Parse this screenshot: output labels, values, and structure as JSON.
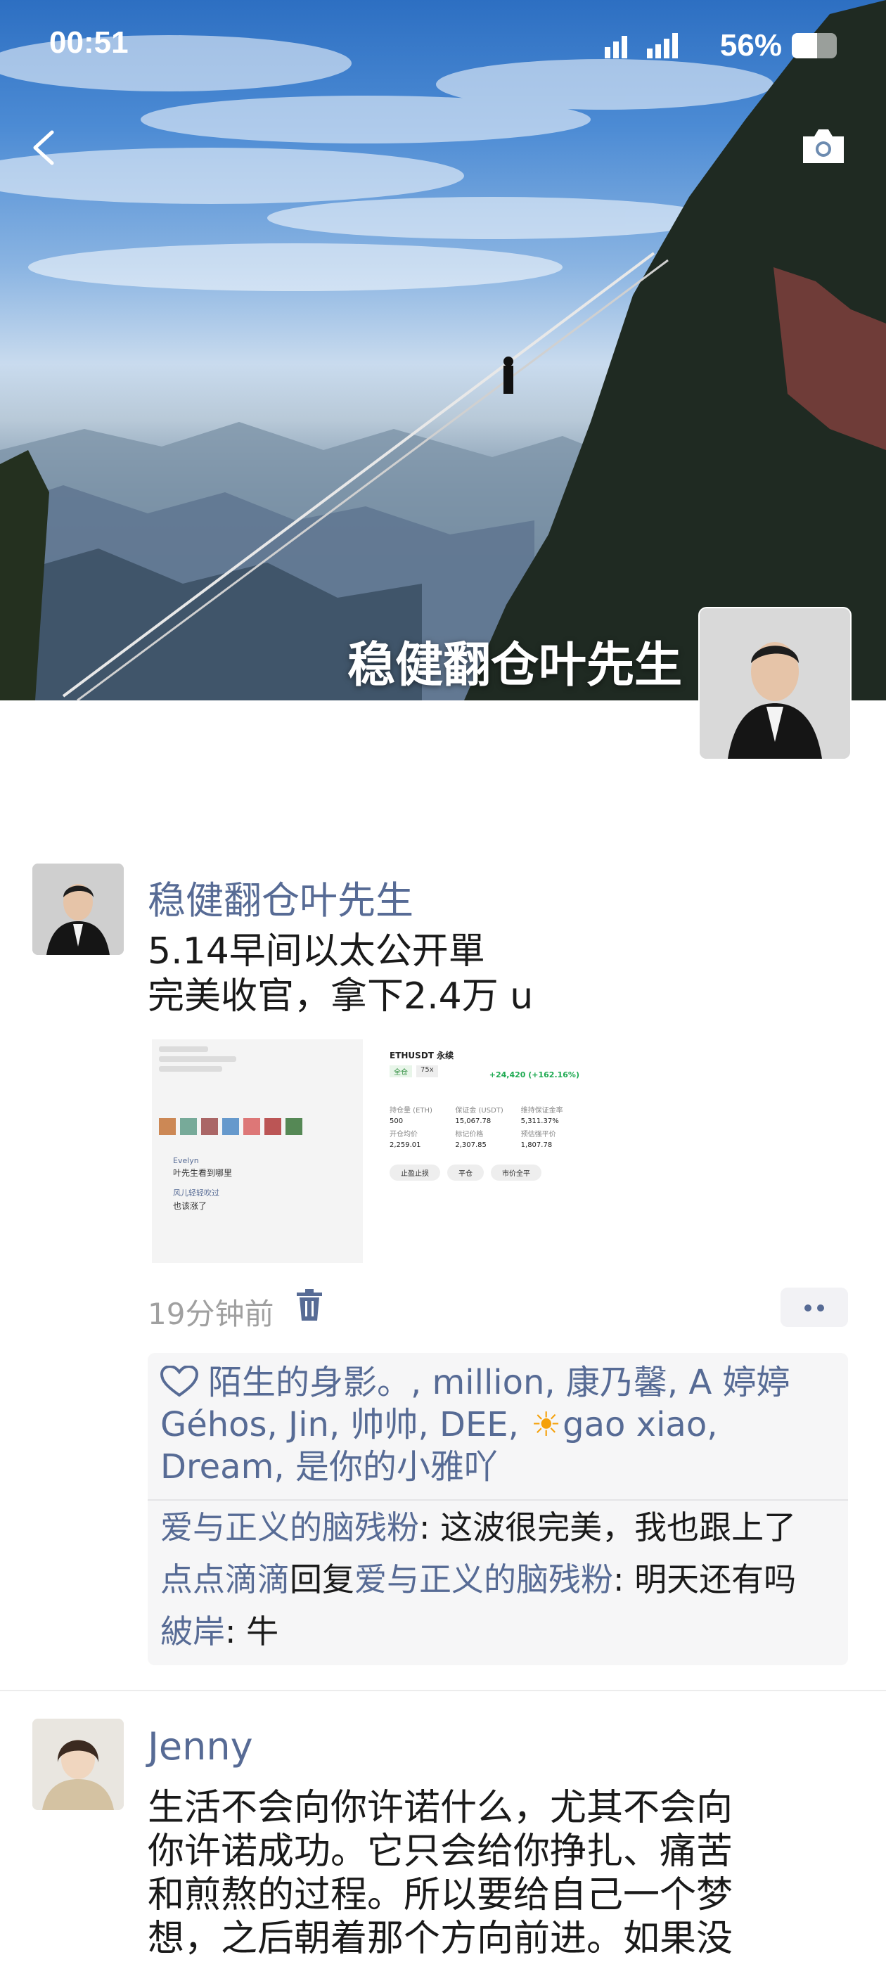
{
  "status_bar": {
    "time": "00:51",
    "battery_text": "56%",
    "battery_level": 0.56
  },
  "cover": {
    "name": "稳健翻仓叶先生"
  },
  "posts": [
    {
      "username": "稳健翻仓叶先生",
      "lines": [
        "5.14早间以太公开單",
        "完美收官，拿下2.4万 u"
      ],
      "time": "19分钟前",
      "likes_text": "陌生的身影。, million, 康乃馨, A 婷婷 Géhos, Jin, 帅帅, DEE, ",
      "likes_sun": "☀",
      "likes_text_2": "gao xiao, Dream, 是你的小雅吖",
      "comments": [
        {
          "author": "爱与正义的脑残粉",
          "sep": ": ",
          "text": "这波很完美，我也跟上了"
        },
        {
          "author": "点点滴滴",
          "reply_word": "回复",
          "reply_to": "爱与正义的脑残粉",
          "sep": ": ",
          "text": "明天还有吗"
        },
        {
          "author": "紴岸",
          "sep": ": ",
          "text": "牛"
        }
      ],
      "screenshot_right": {
        "title": "ETHUSDT 永续",
        "badge": "全仓",
        "leverage": "75x",
        "pnl": "+24,420 (+162.16%)",
        "label_a": "持仓量 (ETH)",
        "val_a": "500",
        "label_b": "保证金 (USDT)",
        "val_b": "15,067.78",
        "label_c": "维持保证金率",
        "val_c": "5,311.37%",
        "label_d": "开仓均价",
        "val_d": "2,259.01",
        "label_e": "标记价格",
        "val_e": "2,307.85",
        "label_f": "预估强平价",
        "val_f": "1,807.78",
        "btn1": "止盈止损",
        "btn2": "平仓",
        "btn3": "市价全平"
      },
      "screenshot_left": {
        "name1": "Evelyn",
        "msg1": "叶先生看到哪里",
        "name2": "风儿轻轻吹过",
        "msg2": "也该涨了"
      }
    },
    {
      "username": "Jenny",
      "lines": [
        "生活不会向你许诺什么，尤其不会向",
        "你许诺成功。它只会给你挣扎、痛苦",
        "和煎熬的过程。所以要给自己一个梦",
        "想，之后朝着那个方向前进。如果没"
      ]
    }
  ]
}
